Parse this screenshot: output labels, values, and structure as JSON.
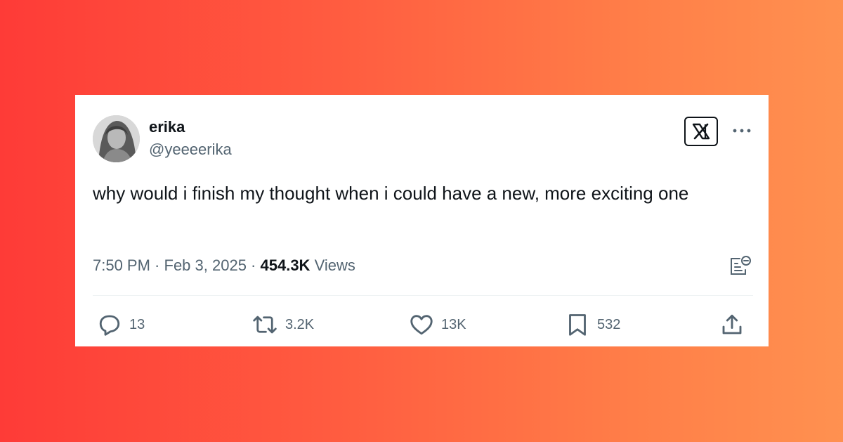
{
  "colors": {
    "background_left": "#fe3b37",
    "background_right": "#ff9150",
    "card": "#ffffff",
    "text_primary": "#0f1419",
    "text_secondary": "#536471"
  },
  "tweet": {
    "author": {
      "name": "erika",
      "handle": "@yeeeerika",
      "avatar_icon": "avatar"
    },
    "platform_icon": "x-logo-icon",
    "more_icon": "more-options-icon",
    "text": "why would i finish my thought when i could have a new, more exciting one",
    "time": "7:50 PM",
    "separator1": " · ",
    "date": "Feb 3, 2025",
    "separator2": " · ",
    "views_count": "454.3K",
    "views_label": " Views",
    "grok_icon": "grok-icon",
    "actions": {
      "replies": {
        "icon": "reply-icon",
        "count": "13"
      },
      "reposts": {
        "icon": "repost-icon",
        "count": "3.2K"
      },
      "likes": {
        "icon": "like-icon",
        "count": "13K"
      },
      "bookmarks": {
        "icon": "bookmark-icon",
        "count": "532"
      },
      "share": {
        "icon": "share-icon"
      }
    }
  }
}
